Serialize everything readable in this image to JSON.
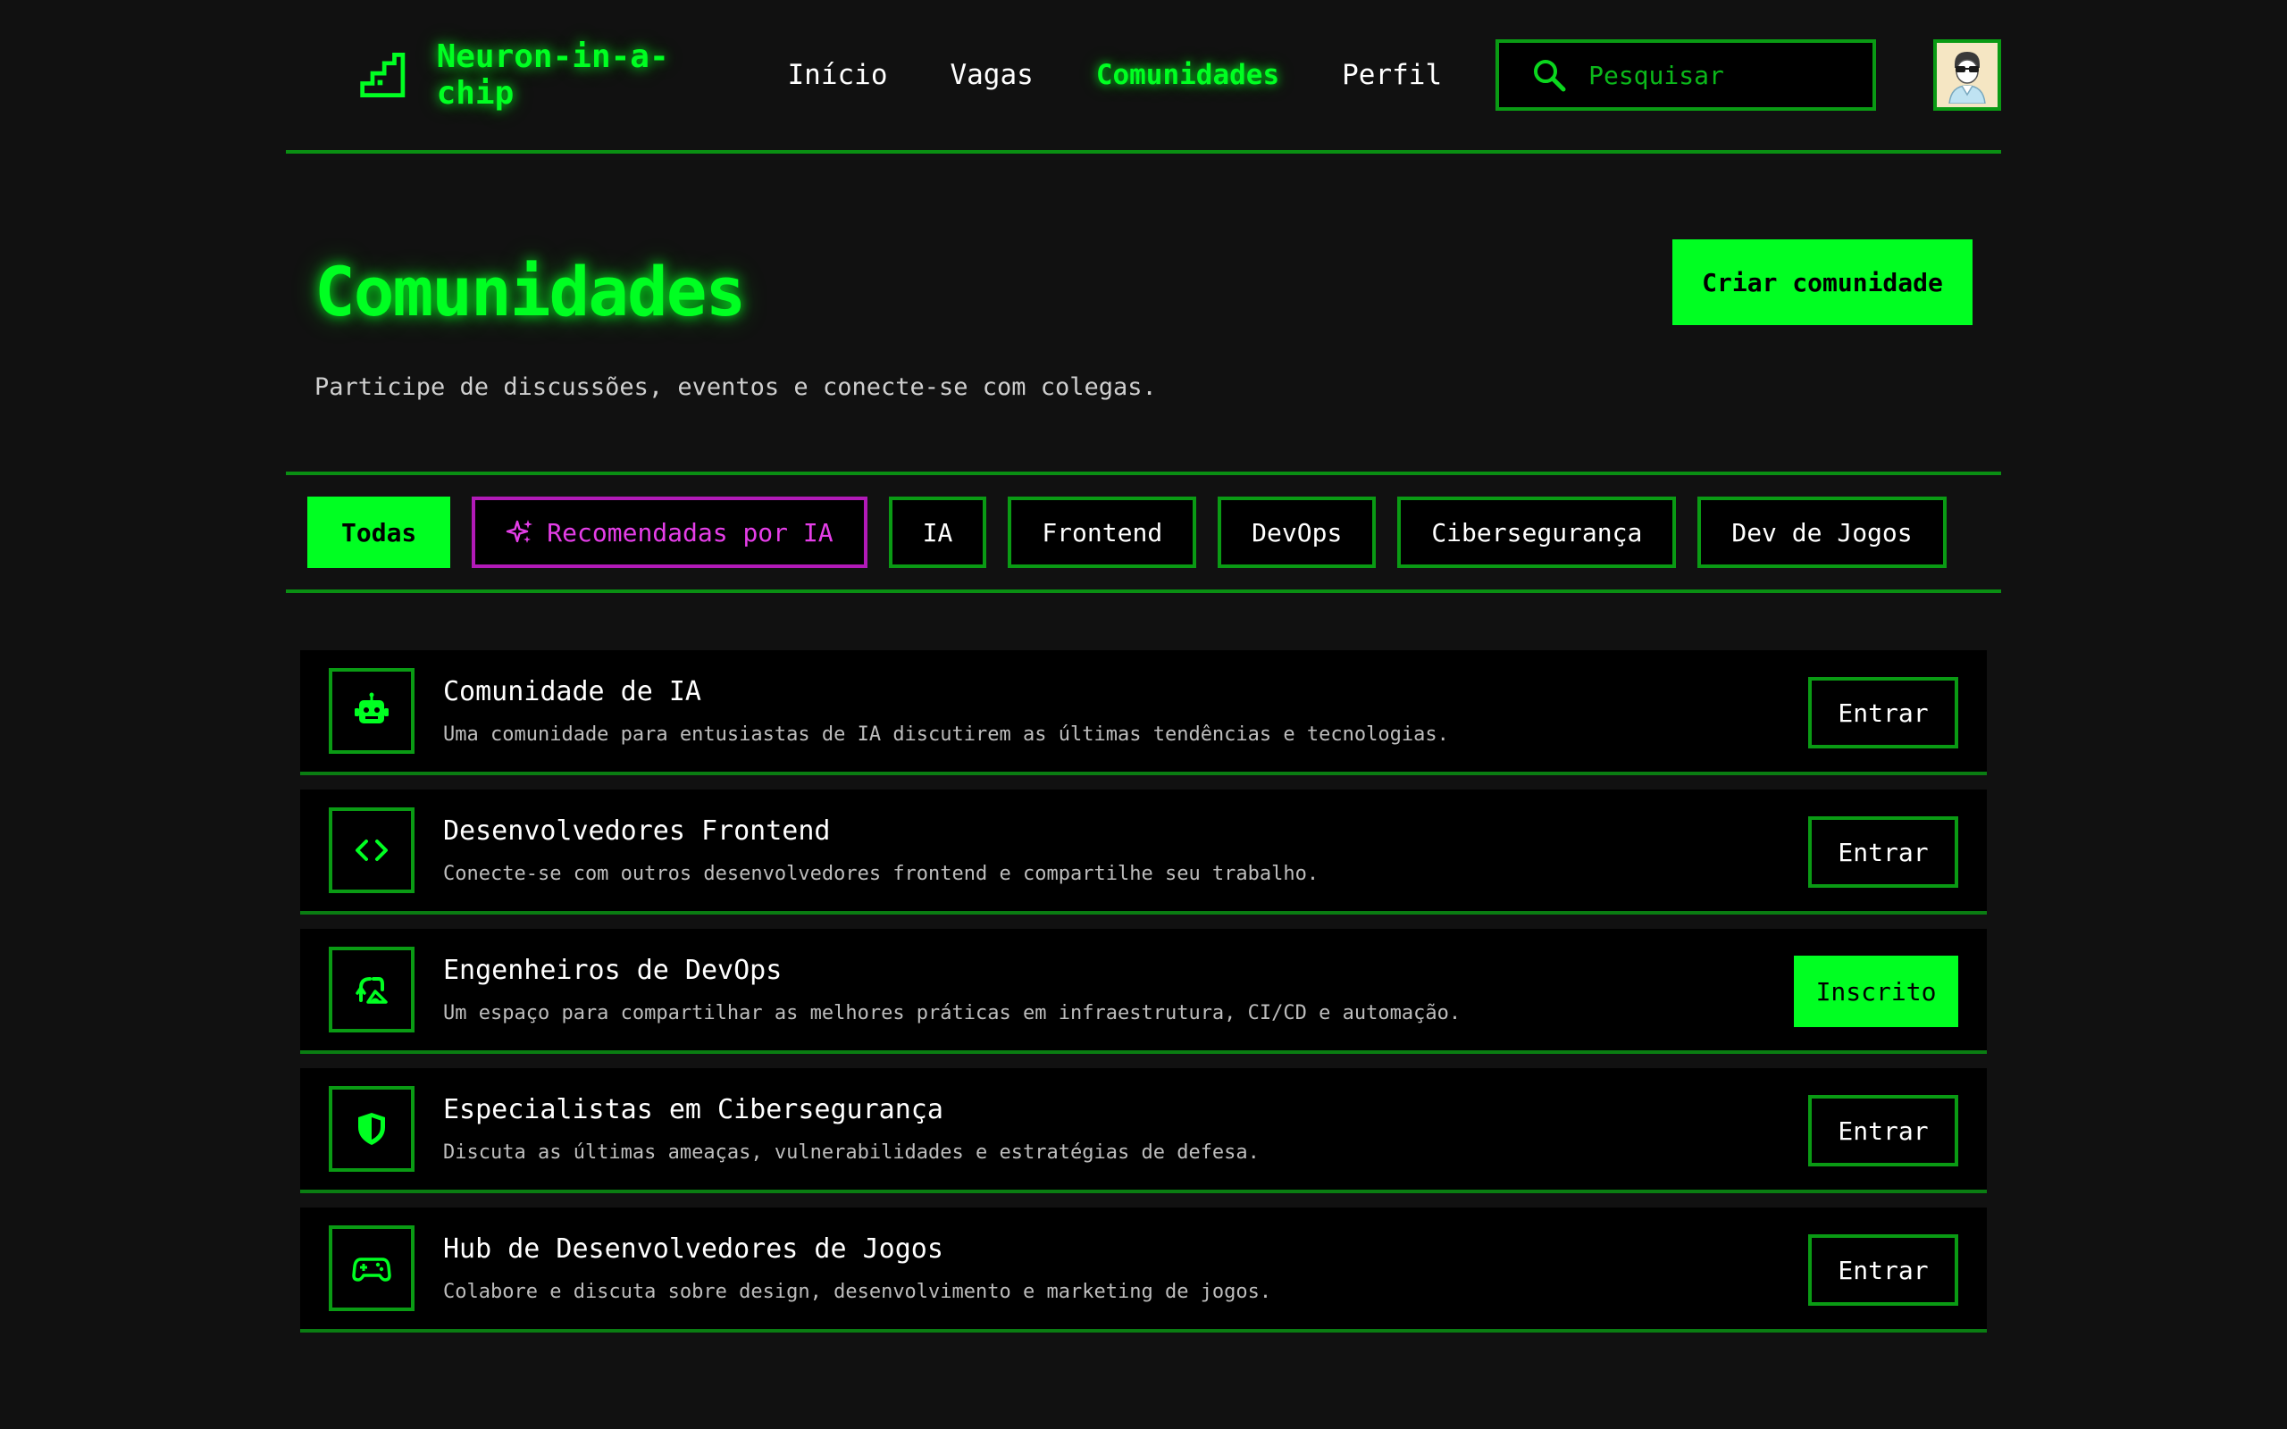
{
  "brand": {
    "name": "Neuron-in-a-chip"
  },
  "nav": {
    "items": [
      {
        "label": "Início",
        "active": false
      },
      {
        "label": "Vagas",
        "active": false
      },
      {
        "label": "Comunidades",
        "active": true
      },
      {
        "label": "Perfil",
        "active": false
      }
    ]
  },
  "search": {
    "placeholder": "Pesquisar",
    "value": ""
  },
  "hero": {
    "title": "Comunidades",
    "subtitle": "Participe de discussões, eventos e conecte-se com colegas.",
    "create_label": "Criar comunidade"
  },
  "filters": {
    "items": [
      {
        "label": "Todas",
        "active": true
      },
      {
        "label": "Recomendadas por IA",
        "icon": "sparkles-icon"
      },
      {
        "label": "IA"
      },
      {
        "label": "Frontend"
      },
      {
        "label": "DevOps"
      },
      {
        "label": "Cibersegurança"
      },
      {
        "label": "Dev de Jogos"
      }
    ]
  },
  "communities": [
    {
      "icon": "robot-icon",
      "title": "Comunidade de IA",
      "desc": "Uma comunidade para entusiastas de IA discutirem as últimas tendências e tecnologias.",
      "action": "Entrar",
      "joined": false
    },
    {
      "icon": "code-icon",
      "title": "Desenvolvedores Frontend",
      "desc": "Conecte-se com outros desenvolvedores frontend e compartilhe seu trabalho.",
      "action": "Entrar",
      "joined": false
    },
    {
      "icon": "cycle-icon",
      "title": "Engenheiros de DevOps",
      "desc": "Um espaço para compartilhar as melhores práticas em infraestrutura, CI/CD e automação.",
      "action": "Inscrito",
      "joined": true
    },
    {
      "icon": "shield-icon",
      "title": "Especialistas em Cibersegurança",
      "desc": "Discuta as últimas ameaças, vulnerabilidades e estratégias de defesa.",
      "action": "Entrar",
      "joined": false
    },
    {
      "icon": "gamepad-icon",
      "title": "Hub de Desenvolvedores de Jogos",
      "desc": "Colabore e discuta sobre design, desenvolvimento e marketing de jogos.",
      "action": "Entrar",
      "joined": false
    }
  ],
  "colors": {
    "accent": "#00ff22",
    "border": "#0a9b14",
    "ai_accent": "#e53ee8",
    "background": "#111111",
    "card": "#000000"
  }
}
